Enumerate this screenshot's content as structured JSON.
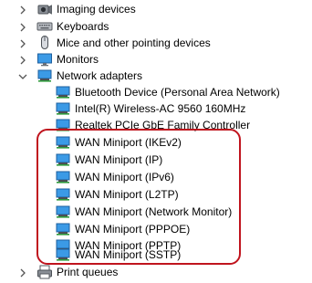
{
  "tree": {
    "categories": [
      {
        "label": "Imaging devices",
        "icon": "camera-icon",
        "expanded": false
      },
      {
        "label": "Keyboards",
        "icon": "keyboard-icon",
        "expanded": false
      },
      {
        "label": "Mice and other pointing devices",
        "icon": "mouse-icon",
        "expanded": false
      },
      {
        "label": "Monitors",
        "icon": "monitor-icon",
        "expanded": false
      },
      {
        "label": "Network adapters",
        "icon": "network-adapter-icon",
        "expanded": true
      }
    ],
    "network_adapters": [
      {
        "label": "Bluetooth Device (Personal Area Network)"
      },
      {
        "label": "Intel(R) Wireless-AC 9560 160MHz"
      },
      {
        "label": "Realtek PCIe GbE Family Controller"
      },
      {
        "label": "WAN Miniport (IKEv2)"
      },
      {
        "label": "WAN Miniport (IP)"
      },
      {
        "label": "WAN Miniport (IPv6)"
      },
      {
        "label": "WAN Miniport (L2TP)"
      },
      {
        "label": "WAN Miniport (Network Monitor)"
      },
      {
        "label": "WAN Miniport (PPPOE)"
      },
      {
        "label": "WAN Miniport (PPTP)"
      },
      {
        "label": "WAN Miniport (SSTP)"
      }
    ],
    "after": [
      {
        "label": "Print queues",
        "icon": "printer-icon",
        "expanded": false
      }
    ]
  },
  "colors": {
    "highlight": "#c0141e",
    "icon_blue": "#2a7fd4"
  }
}
